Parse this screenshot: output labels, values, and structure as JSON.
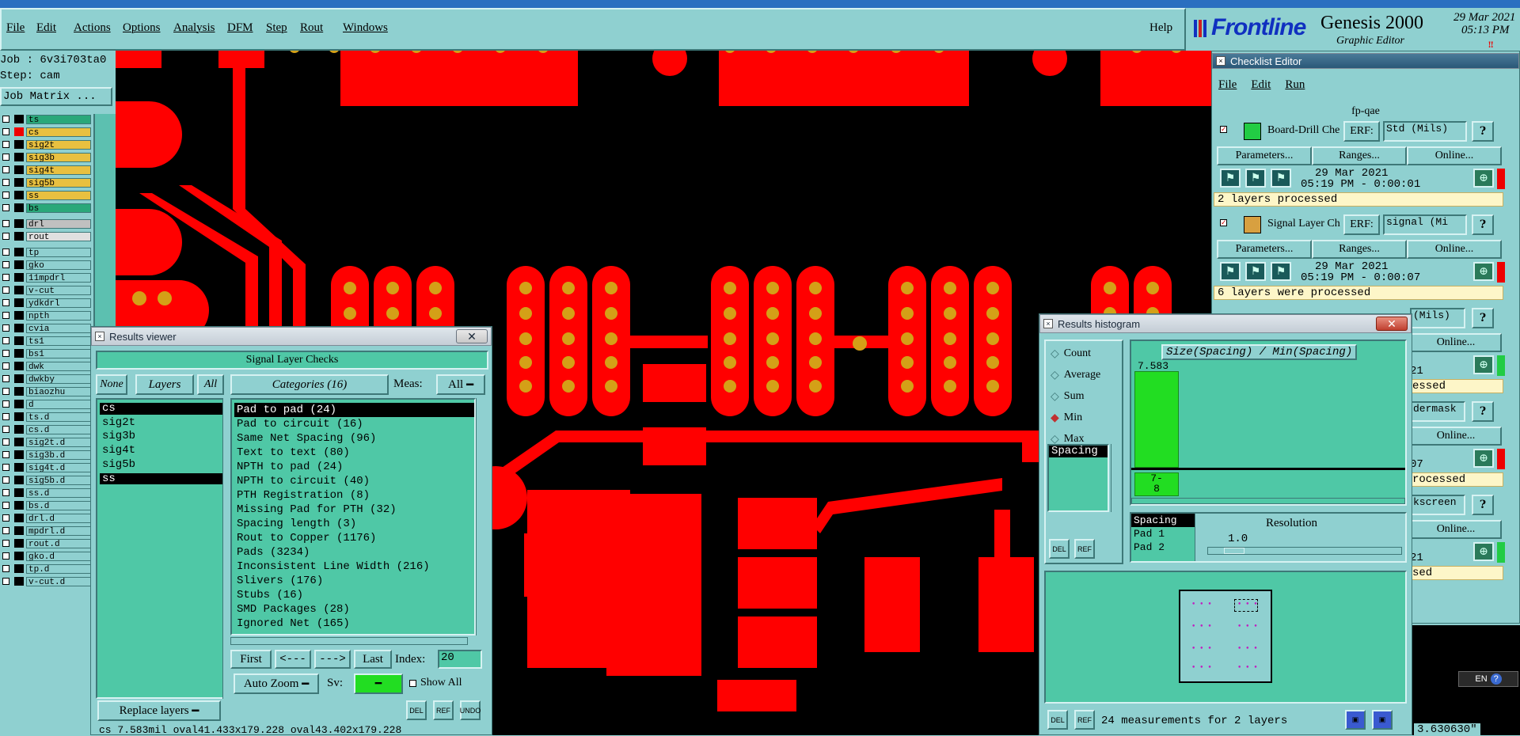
{
  "menubar": {
    "items": [
      "File",
      "Edit",
      "Actions",
      "Options",
      "Analysis",
      "DFM",
      "Step",
      "Rout",
      "Windows"
    ],
    "help": "Help"
  },
  "brand": {
    "logo": "Frontline",
    "product": "Genesis 2000",
    "subtitle": "Graphic Editor",
    "date": "29 Mar 2021",
    "time": "05:13 PM"
  },
  "job": {
    "job_line": "Job : 6v3i703ta0",
    "step_line": "Step: cam",
    "matrix_button": "Job Matrix ..."
  },
  "layers": [
    {
      "name": "ts",
      "color": "#2aa87a",
      "active": false
    },
    {
      "name": "cs",
      "color": "#e8c040",
      "active": true
    },
    {
      "name": "sig2t",
      "color": "#e8c040",
      "active": false
    },
    {
      "name": "sig3b",
      "color": "#e8c040",
      "active": false
    },
    {
      "name": "sig4t",
      "color": "#e8c040",
      "active": false
    },
    {
      "name": "sig5b",
      "color": "#e8c040",
      "active": false
    },
    {
      "name": "ss",
      "color": "#e8c040",
      "active": false
    },
    {
      "name": "bs",
      "color": "#2aa87a",
      "active": false
    },
    {
      "name": "drl",
      "color": "#c0c0c0",
      "active": false
    },
    {
      "name": "rout",
      "color": "#e0e0e0",
      "active": false
    },
    {
      "name": "tp",
      "color": "#8fd0d0",
      "active": false
    },
    {
      "name": "gko",
      "color": "#8fd0d0",
      "active": false
    },
    {
      "name": "11mpdrl",
      "color": "#8fd0d0",
      "active": false
    },
    {
      "name": "v-cut",
      "color": "#8fd0d0",
      "active": false
    },
    {
      "name": "ydkdrl",
      "color": "#8fd0d0",
      "active": false
    },
    {
      "name": "npth",
      "color": "#8fd0d0",
      "active": false
    },
    {
      "name": "cvia",
      "color": "#8fd0d0",
      "active": false
    },
    {
      "name": "ts1",
      "color": "#8fd0d0",
      "active": false
    },
    {
      "name": "bs1",
      "color": "#8fd0d0",
      "active": false
    },
    {
      "name": "dwk",
      "color": "#8fd0d0",
      "active": false
    },
    {
      "name": "dwkby",
      "color": "#8fd0d0",
      "active": false
    },
    {
      "name": "biaozhu",
      "color": "#8fd0d0",
      "active": false
    },
    {
      "name": "d",
      "color": "#8fd0d0",
      "active": false
    },
    {
      "name": "ts.d",
      "color": "#8fd0d0",
      "active": false
    },
    {
      "name": "cs.d",
      "color": "#8fd0d0",
      "active": false
    },
    {
      "name": "sig2t.d",
      "color": "#8fd0d0",
      "active": false
    },
    {
      "name": "sig3b.d",
      "color": "#8fd0d0",
      "active": false
    },
    {
      "name": "sig4t.d",
      "color": "#8fd0d0",
      "active": false
    },
    {
      "name": "sig5b.d",
      "color": "#8fd0d0",
      "active": false
    },
    {
      "name": "ss.d",
      "color": "#8fd0d0",
      "active": false
    },
    {
      "name": "bs.d",
      "color": "#8fd0d0",
      "active": false
    },
    {
      "name": "drl.d",
      "color": "#8fd0d0",
      "active": false
    },
    {
      "name": "mpdrl.d",
      "color": "#8fd0d0",
      "active": false
    },
    {
      "name": "rout.d",
      "color": "#8fd0d0",
      "active": false
    },
    {
      "name": "gko.d",
      "color": "#8fd0d0",
      "active": false
    },
    {
      "name": "tp.d",
      "color": "#8fd0d0",
      "active": false
    },
    {
      "name": "v-cut.d",
      "color": "#8fd0d0",
      "active": false
    }
  ],
  "results_viewer": {
    "window_title": "Results viewer",
    "header": "Signal Layer Checks",
    "btn_none": "None",
    "btn_layers": "Layers",
    "btn_all": "All",
    "btn_categories": "Categories (16)",
    "meas_label": "Meas:",
    "meas_value": "All",
    "layers_list": [
      "cs",
      "sig2t",
      "sig3b",
      "sig4t",
      "sig5b",
      "ss"
    ],
    "categories": [
      "Pad to pad (24)",
      "Pad to circuit (16)",
      "Same Net Spacing (96)",
      "Text to text (80)",
      "NPTH to pad (24)",
      "NPTH to circuit (40)",
      "PTH Registration (8)",
      "Missing Pad for PTH (32)",
      "Spacing length (3)",
      "Rout to Copper (1176)",
      "Pads (3234)",
      "Inconsistent Line Width (216)",
      "Slivers (176)",
      "Stubs (16)",
      "SMD Packages (28)",
      "Ignored Net (165)"
    ],
    "btn_first": "First",
    "btn_prev": "<---",
    "btn_next": "--->",
    "btn_last": "Last",
    "index_label": "Index:",
    "index_value": "20",
    "auto_zoom": "Auto Zoom",
    "sv_label": "Sv:",
    "show_all": "Show All",
    "replace_layers": "Replace layers",
    "del": "DEL",
    "ref": "REF",
    "undo": "UNDO",
    "status": "cs 7.583mil  oval41.433x179.228  oval43.402x179.228"
  },
  "checklist": {
    "window_title": "Checklist Editor",
    "menu": [
      "File",
      "Edit",
      "Run"
    ],
    "name": "fp-qae",
    "checks": [
      {
        "title": "Board-Drill Che",
        "erf_label": "ERF:",
        "erf_value": "Std (Mils)",
        "params": "Parameters...",
        "ranges": "Ranges...",
        "online": "Online...",
        "date": "29 Mar 2021",
        "time": "05:19 PM - 0:00:01",
        "status": "2 layers processed"
      },
      {
        "title": "Signal Layer Ch",
        "erf_label": "ERF:",
        "erf_value": "signal (Mi",
        "params": "Parameters...",
        "ranges": "Ranges...",
        "online": "Online...",
        "date": "29 Mar 2021",
        "time": "05:19 PM - 0:00:07",
        "status": "6 layers were processed"
      }
    ],
    "partial": {
      "erf3": "(Mils)",
      "online3": "Online...",
      "date3": "21",
      "status3": "essed",
      "erf4": "dermask",
      "online4": "Online...",
      "date4": "07",
      "status4": "rocessed",
      "erf5": "kscreen",
      "online5": "Online...",
      "date5": "21",
      "status5": "sed"
    }
  },
  "histogram": {
    "window_title": "Results histogram",
    "modes": [
      "Count",
      "Average",
      "Sum",
      "Min",
      "Max"
    ],
    "selected_mode": "Min",
    "list_item": "Spacing",
    "chart_title": "Size(Spacing) / Min(Spacing)",
    "bar_value": "7.583",
    "bin_label_1": "7-",
    "bin_label_2": "8",
    "attrs": [
      "Spacing",
      "Pad 1",
      "Pad 2"
    ],
    "resolution_label": "Resolution",
    "resolution_value": "1.0",
    "summary": "24 measurements for 2 layers",
    "del": "DEL",
    "ref": "REF"
  },
  "coord_readout": "3.630630\"",
  "lang_badge": "EN",
  "colors": {
    "copper": "#ff0000",
    "pad_hole": "#d4a017",
    "canvas": "#000000",
    "panel": "#8fd0d0",
    "list_bg": "#4fc8a6",
    "bar": "#22dd22"
  }
}
